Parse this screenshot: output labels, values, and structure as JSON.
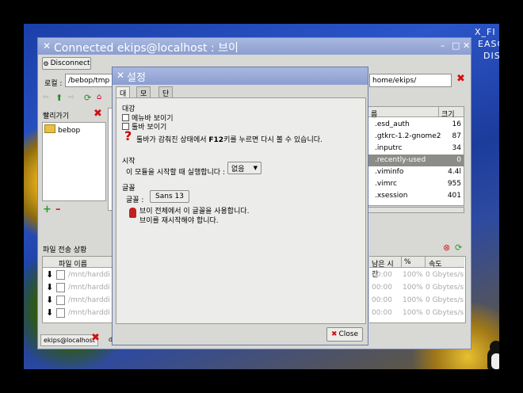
{
  "desktop": {
    "corner_lines": [
      "X_FI",
      "EASC",
      "DIS"
    ]
  },
  "main": {
    "title": "Connected ekips@localhost : 브이",
    "disconnect": "Disconnect",
    "local_label": "로컬 :",
    "local_path": "/bebop/tmp",
    "remote_path": "home/ekips/",
    "bookmarks_title": "빨리가기",
    "bookmarks": [
      "bebop"
    ],
    "remote_header": {
      "name": "름",
      "size": "크기"
    },
    "remote_files": [
      {
        "name": ".esd_auth",
        "size": "16"
      },
      {
        "name": ".gtkrc-1.2-gnome2",
        "size": "87"
      },
      {
        "name": ".inputrc",
        "size": "34"
      },
      {
        "name": ".recently-used",
        "size": "0"
      },
      {
        "name": ".viminfo",
        "size": "4.4l"
      },
      {
        "name": ".vimrc",
        "size": "955"
      },
      {
        "name": ".xsession",
        "size": "401"
      }
    ],
    "transfer_title": "파일 전송 상황",
    "transfer_headers": {
      "file": "파일 이름",
      "remaining": "남은 시간",
      "pct": "%",
      "speed": "속도"
    },
    "transfers": [
      {
        "file": "/mnt/harddi",
        "remaining": "00:00",
        "pct": "100%",
        "speed": "0 Gbytes/s"
      },
      {
        "file": "/mnt/harddi",
        "remaining": "00:00",
        "pct": "100%",
        "speed": "0 Gbytes/s"
      },
      {
        "file": "/mnt/harddi",
        "remaining": "00:00",
        "pct": "100%",
        "speed": "0 Gbytes/s"
      },
      {
        "file": "/mnt/harddi",
        "remaining": "00:00",
        "pct": "100%",
        "speed": "0 Gbytes/s"
      }
    ],
    "bottom_tab": "ekips@localhost",
    "bottom_tab2": "d"
  },
  "dialog": {
    "title": "설정",
    "tabs": [
      "대강",
      "모듈",
      "단축키"
    ],
    "section_general": "대강",
    "opt_menubar": "메뉴바 보이기",
    "opt_toolbar": "툴바 보이기",
    "hint_prefix": "툴바가 감춰진 상태에서 ",
    "hint_key": "F12",
    "hint_suffix": "키를 누르면 다시 볼 수 있습니다.",
    "section_start": "시작",
    "start_label": "이 모듈을 시작할 때 실행합니다 :",
    "start_value": "없음",
    "section_font": "글꼴",
    "font_label": "글꼴 :",
    "font_value": "Sans  13",
    "font_note1": "브이 전체에서 이 글꼴을 사용합니다.",
    "font_note2": "브이를 재시작해야 합니다.",
    "close": "Close"
  }
}
